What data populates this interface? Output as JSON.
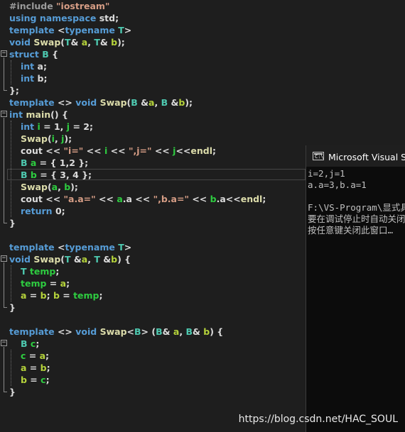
{
  "colors": {
    "background": "#1e1e1e",
    "keyword": "#569cd6",
    "preprocessor": "#9b9b9b",
    "string": "#d69d85",
    "type": "#4ec9b0",
    "function": "#dcdcaa",
    "parameter": "#b5d33b",
    "local": "#2ecc40",
    "member": "#dadada",
    "macro": "#beb7ff",
    "text": "#dcdcdc"
  },
  "editor": {
    "lines": [
      [
        [
          "#include ",
          "preprocessor"
        ],
        [
          "\"iostream\"",
          "string"
        ]
      ],
      [
        [
          "using ",
          "keyword"
        ],
        [
          "namespace ",
          "keyword"
        ],
        [
          "std",
          "text"
        ],
        [
          ";",
          "text"
        ]
      ],
      [
        [
          "template ",
          "keyword"
        ],
        [
          "<",
          "text"
        ],
        [
          "typename ",
          "keyword"
        ],
        [
          "T",
          "type"
        ],
        [
          ">",
          "text"
        ]
      ],
      [
        [
          "void ",
          "keyword"
        ],
        [
          "Swap",
          "function"
        ],
        [
          "(",
          "text"
        ],
        [
          "T",
          "type"
        ],
        [
          "& ",
          "text"
        ],
        [
          "a",
          "parameter"
        ],
        [
          ", ",
          "text"
        ],
        [
          "T",
          "type"
        ],
        [
          "& ",
          "text"
        ],
        [
          "b",
          "parameter"
        ],
        [
          ");",
          "text"
        ]
      ],
      [
        [
          "struct ",
          "keyword"
        ],
        [
          "B",
          "type"
        ],
        [
          " {",
          "text"
        ]
      ],
      [
        [
          "int ",
          "keyword"
        ],
        [
          "a",
          "member"
        ],
        [
          ";",
          "text"
        ]
      ],
      [
        [
          "int ",
          "keyword"
        ],
        [
          "b",
          "member"
        ],
        [
          ";",
          "text"
        ]
      ],
      [
        [
          "};",
          "text"
        ]
      ],
      [
        [
          "template ",
          "keyword"
        ],
        [
          "<> ",
          "text"
        ],
        [
          "void ",
          "keyword"
        ],
        [
          "Swap",
          "function"
        ],
        [
          "(",
          "text"
        ],
        [
          "B ",
          "type"
        ],
        [
          "&",
          "text"
        ],
        [
          "a",
          "parameter"
        ],
        [
          ", ",
          "text"
        ],
        [
          "B ",
          "type"
        ],
        [
          "&",
          "text"
        ],
        [
          "b",
          "parameter"
        ],
        [
          ");",
          "text"
        ]
      ],
      [
        [
          "int ",
          "keyword"
        ],
        [
          "main",
          "function"
        ],
        [
          "() {",
          "text"
        ]
      ],
      [
        [
          "int ",
          "keyword"
        ],
        [
          "i",
          "local"
        ],
        [
          " = 1, ",
          "text"
        ],
        [
          "j",
          "local"
        ],
        [
          " = 2;",
          "text"
        ]
      ],
      [
        [
          "Swap",
          "function"
        ],
        [
          "(",
          "text"
        ],
        [
          "i",
          "local"
        ],
        [
          ", ",
          "text"
        ],
        [
          "j",
          "local"
        ],
        [
          ");",
          "text"
        ]
      ],
      [
        [
          "cout",
          "text"
        ],
        [
          " << ",
          "text"
        ],
        [
          "\"i=\"",
          "string"
        ],
        [
          " << ",
          "text"
        ],
        [
          "i",
          "local"
        ],
        [
          " << ",
          "text"
        ],
        [
          "\",j=\"",
          "string"
        ],
        [
          " << ",
          "text"
        ],
        [
          "j",
          "local"
        ],
        [
          "<<",
          "text"
        ],
        [
          "endl",
          "function"
        ],
        [
          ";",
          "text"
        ]
      ],
      [
        [
          "B ",
          "type"
        ],
        [
          "a",
          "local"
        ],
        [
          " = { 1,2 };",
          "text"
        ]
      ],
      [
        [
          "B ",
          "type"
        ],
        [
          "b",
          "local"
        ],
        [
          " = { 3, 4 };",
          "text"
        ]
      ],
      [
        [
          "Swap",
          "function"
        ],
        [
          "(",
          "text"
        ],
        [
          "a",
          "local"
        ],
        [
          ", ",
          "text"
        ],
        [
          "b",
          "local"
        ],
        [
          ");",
          "text"
        ]
      ],
      [
        [
          "cout",
          "text"
        ],
        [
          " << ",
          "text"
        ],
        [
          "\"a.a=\"",
          "string"
        ],
        [
          " << ",
          "text"
        ],
        [
          "a",
          "local"
        ],
        [
          ".",
          "text"
        ],
        [
          "a",
          "member"
        ],
        [
          " << ",
          "text"
        ],
        [
          "\",b.a=\"",
          "string"
        ],
        [
          " << ",
          "text"
        ],
        [
          "b",
          "local"
        ],
        [
          ".",
          "text"
        ],
        [
          "a",
          "member"
        ],
        [
          "<<",
          "text"
        ],
        [
          "endl",
          "function"
        ],
        [
          ";",
          "text"
        ]
      ],
      [
        [
          "return ",
          "keyword"
        ],
        [
          "0",
          "text"
        ],
        [
          ";",
          "text"
        ]
      ],
      [
        [
          "}",
          "text"
        ]
      ],
      [],
      [
        [
          "template ",
          "keyword"
        ],
        [
          "<",
          "text"
        ],
        [
          "typename ",
          "keyword"
        ],
        [
          "T",
          "type"
        ],
        [
          ">",
          "text"
        ]
      ],
      [
        [
          "void ",
          "keyword"
        ],
        [
          "Swap",
          "function"
        ],
        [
          "(",
          "text"
        ],
        [
          "T ",
          "type"
        ],
        [
          "&",
          "text"
        ],
        [
          "a",
          "parameter"
        ],
        [
          ", ",
          "text"
        ],
        [
          "T ",
          "type"
        ],
        [
          "&",
          "text"
        ],
        [
          "b",
          "parameter"
        ],
        [
          ") {",
          "text"
        ]
      ],
      [
        [
          "T ",
          "type"
        ],
        [
          "temp",
          "local"
        ],
        [
          ";",
          "text"
        ]
      ],
      [
        [
          "temp",
          "local"
        ],
        [
          " = ",
          "text"
        ],
        [
          "a",
          "parameter"
        ],
        [
          ";",
          "text"
        ]
      ],
      [
        [
          "a",
          "parameter"
        ],
        [
          " = ",
          "text"
        ],
        [
          "b",
          "parameter"
        ],
        [
          "; ",
          "text"
        ],
        [
          "b",
          "parameter"
        ],
        [
          " = ",
          "text"
        ],
        [
          "temp",
          "local"
        ],
        [
          ";",
          "text"
        ]
      ],
      [
        [
          "}",
          "text"
        ]
      ],
      [],
      [
        [
          "template ",
          "keyword"
        ],
        [
          "<> ",
          "text"
        ],
        [
          "void ",
          "keyword"
        ],
        [
          "Swap",
          "function"
        ],
        [
          "<",
          "text"
        ],
        [
          "B",
          "type"
        ],
        [
          "> (",
          "text"
        ],
        [
          "B",
          "type"
        ],
        [
          "& ",
          "text"
        ],
        [
          "a",
          "parameter"
        ],
        [
          ", ",
          "text"
        ],
        [
          "B",
          "type"
        ],
        [
          "& ",
          "text"
        ],
        [
          "b",
          "parameter"
        ],
        [
          ") {",
          "text"
        ]
      ],
      [
        [
          "B ",
          "type"
        ],
        [
          "c",
          "local"
        ],
        [
          ";",
          "text"
        ]
      ],
      [
        [
          "c",
          "local"
        ],
        [
          " = ",
          "text"
        ],
        [
          "a",
          "parameter"
        ],
        [
          ";",
          "text"
        ]
      ],
      [
        [
          "a",
          "parameter"
        ],
        [
          " = ",
          "text"
        ],
        [
          "b",
          "parameter"
        ],
        [
          ";",
          "text"
        ]
      ],
      [
        [
          "b",
          "parameter"
        ],
        [
          " = ",
          "text"
        ],
        [
          "c",
          "local"
        ],
        [
          ";",
          "text"
        ]
      ],
      [
        [
          "}",
          "text"
        ]
      ]
    ]
  },
  "console": {
    "title": "Microsoft Visual Studio 调试控制台",
    "icon": "console-window-icon",
    "icon_text": "C:\\",
    "output_lines": [
      "i=2,j=1",
      "a.a=3,b.a=1",
      "",
      "F:\\VS-Program\\显式具体化.exe",
      "要在调试停止时自动关闭控制台",
      "按任意键关闭此窗口…"
    ]
  },
  "watermark": "https://blog.csdn.net/HAC_SOUL"
}
